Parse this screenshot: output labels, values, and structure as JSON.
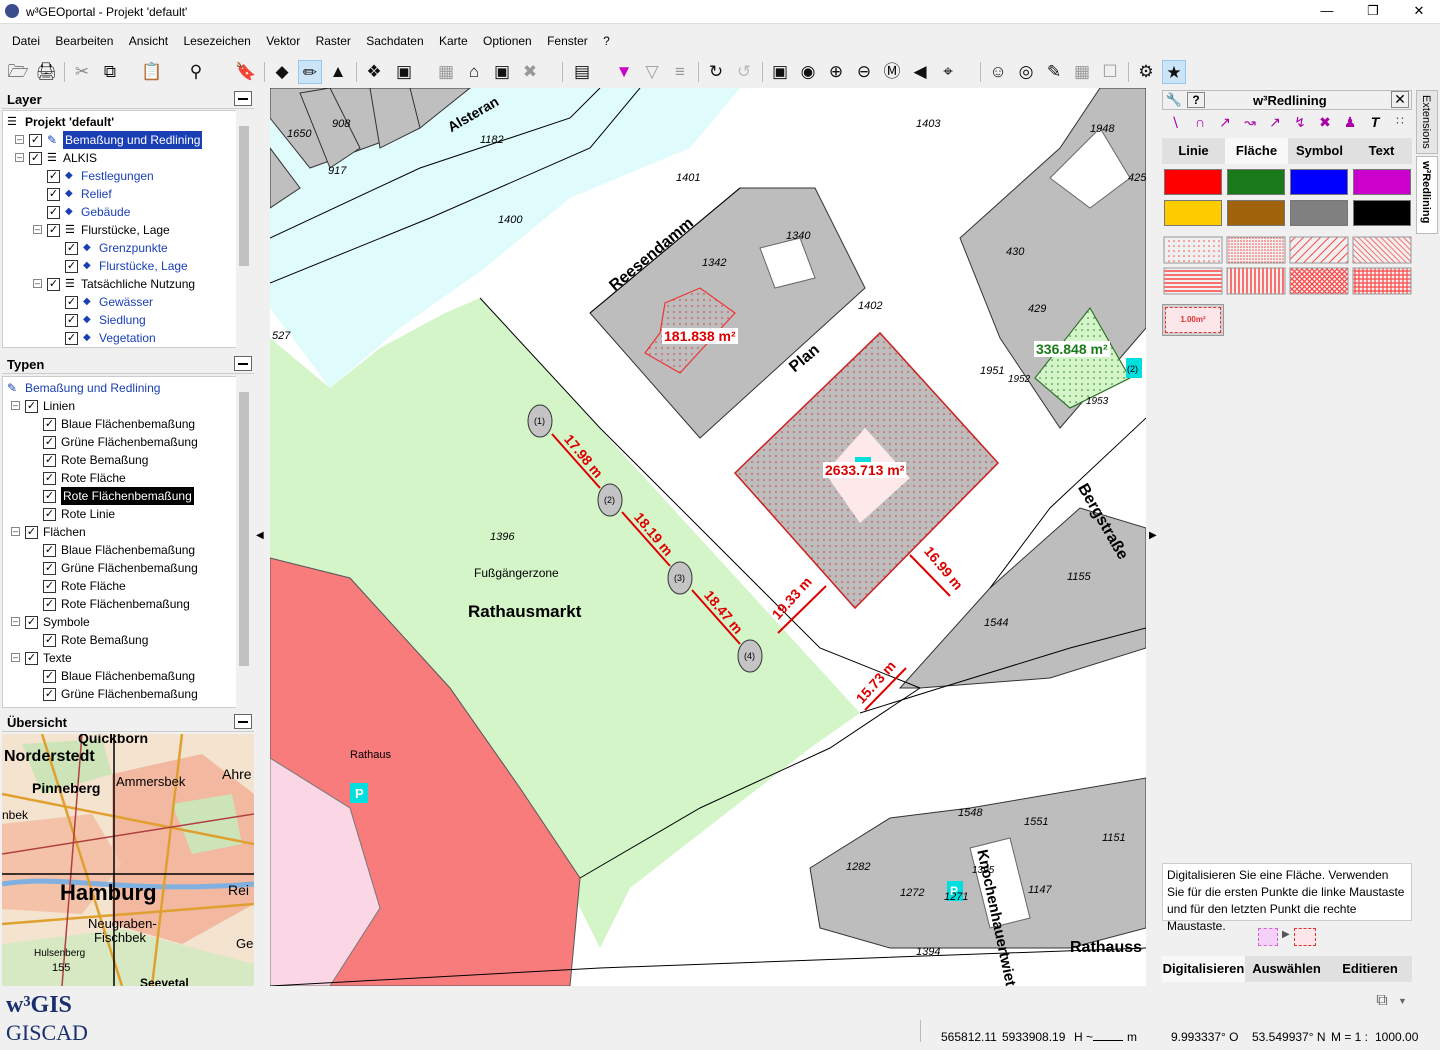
{
  "window": {
    "title": "w³GEOportal - Projekt 'default'"
  },
  "menu": [
    "Datei",
    "Bearbeiten",
    "Ansicht",
    "Lesezeichen",
    "Vektor",
    "Raster",
    "Sachdaten",
    "Karte",
    "Optionen",
    "Fenster",
    "?"
  ],
  "layer_panel": {
    "title": "Layer",
    "items": [
      {
        "label": "Projekt 'default'",
        "checked": true,
        "indent": 0
      },
      {
        "label": "Bemaßung und Redlining",
        "checked": true,
        "indent": 1,
        "selected": true
      },
      {
        "label": "ALKIS",
        "checked": true,
        "indent": 1
      },
      {
        "label": "Festlegungen",
        "checked": true,
        "indent": 2
      },
      {
        "label": "Relief",
        "checked": true,
        "indent": 2
      },
      {
        "label": "Gebäude",
        "checked": true,
        "indent": 2
      },
      {
        "label": "Flurstücke, Lage",
        "checked": true,
        "indent": 2
      },
      {
        "label": "Grenzpunkte",
        "checked": true,
        "indent": 3
      },
      {
        "label": "Flurstücke, Lage",
        "checked": true,
        "indent": 3
      },
      {
        "label": "Tatsächliche Nutzung",
        "checked": true,
        "indent": 2
      },
      {
        "label": "Gewässer",
        "checked": true,
        "indent": 3
      },
      {
        "label": "Siedlung",
        "checked": true,
        "indent": 3
      },
      {
        "label": "Vegetation",
        "checked": true,
        "indent": 3
      }
    ]
  },
  "types_panel": {
    "title": "Typen",
    "items": [
      {
        "label": "Bemaßung und Redlining",
        "indent": 0
      },
      {
        "label": "Linien",
        "indent": 1
      },
      {
        "label": "Blaue Flächenbemaßung",
        "indent": 2
      },
      {
        "label": "Grüne Flächenbemaßung",
        "indent": 2
      },
      {
        "label": "Rote Bemaßung",
        "indent": 2
      },
      {
        "label": "Rote Fläche",
        "indent": 2
      },
      {
        "label": "Rote Flächenbemaßung",
        "indent": 2,
        "selected": true
      },
      {
        "label": "Rote Linie",
        "indent": 2
      },
      {
        "label": "Flächen",
        "indent": 1
      },
      {
        "label": "Blaue Flächenbemaßung",
        "indent": 2
      },
      {
        "label": "Grüne Flächenbemaßung",
        "indent": 2
      },
      {
        "label": "Rote Fläche",
        "indent": 2
      },
      {
        "label": "Rote Flächenbemaßung",
        "indent": 2
      },
      {
        "label": "Symbole",
        "indent": 1
      },
      {
        "label": "Rote Bemaßung",
        "indent": 2
      },
      {
        "label": "Texte",
        "indent": 1
      },
      {
        "label": "Blaue Flächenbemaßung",
        "indent": 2
      },
      {
        "label": "Grüne Flächenbemaßung",
        "indent": 2
      }
    ]
  },
  "overview": {
    "title": "Übersicht",
    "places": [
      "Quickborn",
      "Norderstedt",
      "Ammersbek",
      "Ahre",
      "Pinneberg",
      "nbek",
      "Hamburg",
      "Rei",
      "Neugraben-",
      "Fischbek",
      "Hulsenberg",
      "155",
      "Geo",
      "Seevetal"
    ]
  },
  "map": {
    "parcels": [
      "1650",
      "908",
      "917",
      "1182",
      "1403",
      "1948",
      "425",
      "1401",
      "1400",
      "1340",
      "1342",
      "430",
      "429",
      "1402",
      "1951",
      "1952",
      "1953",
      "527",
      "1396",
      "1155",
      "1544",
      "1548",
      "1551",
      "1151",
      "1282",
      "1395",
      "1272",
      "1271",
      "1147",
      "1394"
    ],
    "streets": [
      "Alsteran",
      "Reesendamm",
      "Plan",
      "Bergstraße",
      "Fußgängerzone",
      "Rathausmarkt",
      "Rathaus",
      "Knochenhauertwiete",
      "Rathauss"
    ],
    "areas": {
      "red1": "181.838 m²",
      "red2": "2633.713 m²",
      "green": "336.848 m²"
    },
    "dimensions": [
      "17.98 m",
      "18.19 m",
      "18.47 m",
      "19.33 m",
      "15.73 m",
      "16.99 m"
    ],
    "points": [
      "(1)",
      "(2)",
      "(3)",
      "(4)"
    ],
    "parking": [
      "P",
      "P",
      "(2)"
    ]
  },
  "redlining": {
    "title": "w³Redlining",
    "tabs": [
      "Linie",
      "Fläche",
      "Symbol",
      "Text"
    ],
    "active_tab": "Fläche",
    "colors": [
      "#ff0000",
      "#1a7a1a",
      "#0000ff",
      "#cc00cc",
      "#ffcc00",
      "#a0620a",
      "#808080",
      "#000000"
    ],
    "pattern_label": "1.00m²",
    "hint": "Digitalisieren Sie eine Fläche. Verwenden Sie für die ersten Punkte die linke Maustaste und für den letzten Punkt die rechte Maustaste.",
    "bottom_tabs": [
      "Digitalisieren",
      "Auswählen",
      "Editieren"
    ],
    "side_tabs": [
      "Extensions",
      "w³Redlining"
    ]
  },
  "branding": {
    "w3gis": "w³GIS",
    "giscad": "GISCAD"
  },
  "status": {
    "x": "565812.11",
    "y": "5933908.19",
    "h_label": "H ~",
    "h_unit": "m",
    "lon": "9.993337° O",
    "lat": "53.549937° N",
    "scale": "M = 1 :",
    "scale_value": "1000.00"
  }
}
